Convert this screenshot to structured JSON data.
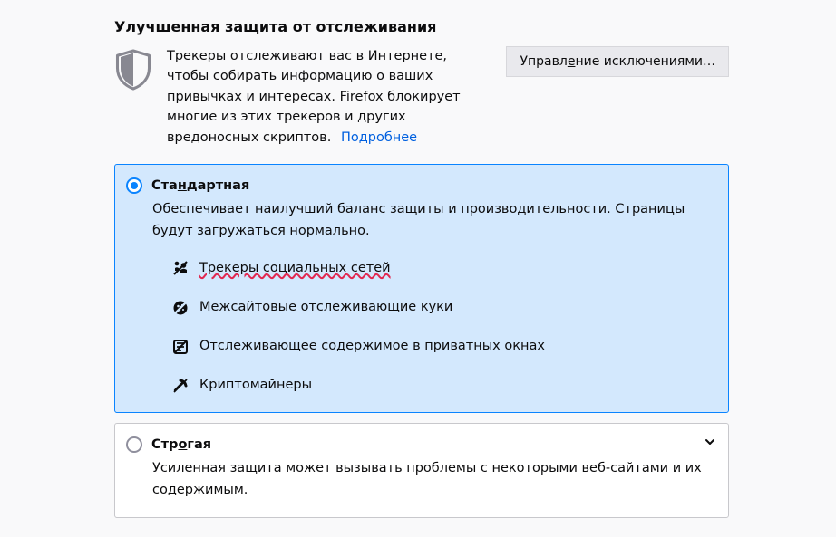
{
  "section": {
    "title": "Улучшенная защита от отслеживания",
    "intro_pre": "Трекеры отслеживают вас в Интернете, чтобы собирать информацию о ваших привычках и интересах. Firefox блокирует многие из этих трекеров и других вредоносных скриптов.",
    "learn_more": "Подробнее",
    "manage_exceptions": "Управление исключениями…"
  },
  "options": {
    "standard": {
      "label": "Стандартная",
      "label_pre": "Ста",
      "label_u": "н",
      "label_post": "дартная",
      "desc": "Обеспечивает наилучший баланс защиты и производительности. Страницы будут загружаться нормально.",
      "features": [
        "Трекеры социальных сетей",
        "Межсайтовые отслеживающие куки",
        "Отслеживающее содержимое в приватных окнах",
        "Криптомайнеры"
      ]
    },
    "strict": {
      "label": "Строгая",
      "label_pre": "Стр",
      "label_u": "о",
      "label_post": "гая",
      "desc": "Усиленная защита может вызывать проблемы с некоторыми веб-сайтами и их содержимым."
    }
  },
  "colors": {
    "accent": "#0a84ff",
    "link": "#0060df",
    "selected_bg": "#d3e8fd"
  }
}
